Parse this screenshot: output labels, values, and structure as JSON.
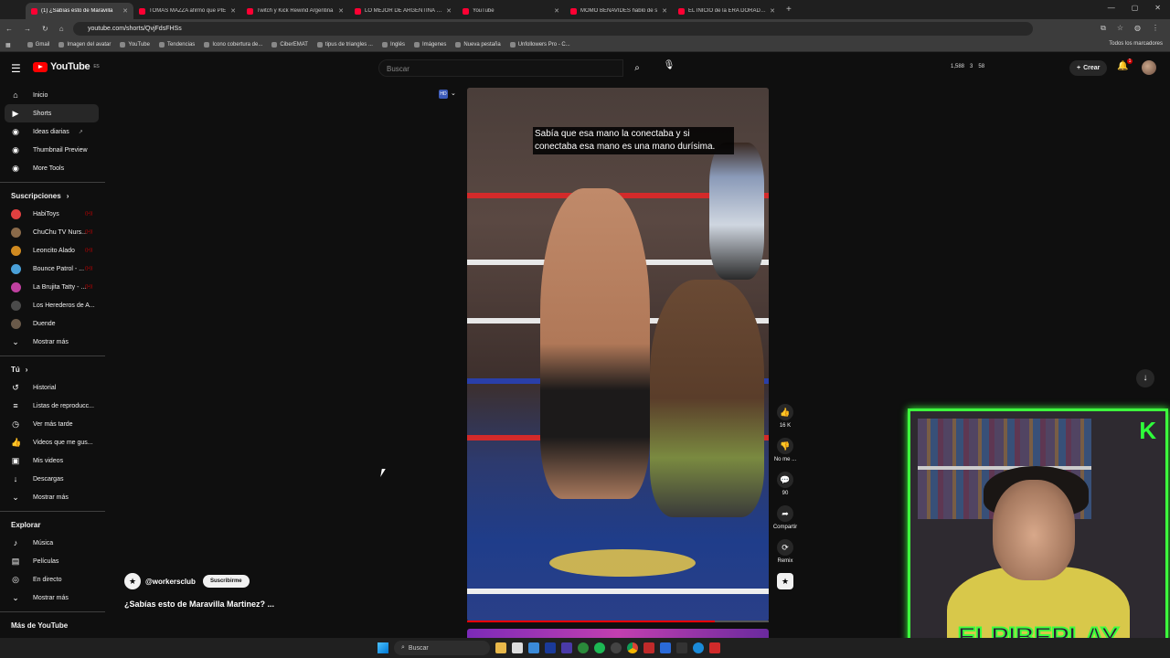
{
  "browser": {
    "tabs": [
      {
        "title": "(1) ¿Sabías esto de Maravilla",
        "active": true
      },
      {
        "title": "TOMAS MAZZA afirmó que PIE",
        "active": false
      },
      {
        "title": "Twitch y Kick Rewind Argentina",
        "active": false
      },
      {
        "title": "LO MEJOR DE ARGENTINA 2023",
        "active": false
      },
      {
        "title": "YouTube",
        "active": false
      },
      {
        "title": "MOMO BENAVIDES habló de s",
        "active": false
      },
      {
        "title": "EL INICIO de la ERA DORADA |",
        "active": false
      }
    ],
    "url": "youtube.com/shorts/QvjFdsFHSs",
    "bookmarks": [
      "Gmail",
      "Imagen del avatar",
      "YouTube",
      "Tendencias",
      "Icono cobertura de...",
      "CiberEMAT",
      "tipus de triangles ...",
      "Inglés",
      "Imágenes",
      "Nueva pestaña",
      "Unfollowers Pro - C..."
    ],
    "bookmarks_right": "Todos los marcadores"
  },
  "youtube": {
    "logo": "YouTube",
    "logo_sup": "ES",
    "search_placeholder": "Buscar",
    "stats": {
      "views": "1,588",
      "a": "3",
      "b": "58"
    },
    "create_label": "Crear",
    "notif_count": "1"
  },
  "sidebar": {
    "main": [
      {
        "label": "Inicio",
        "icon": "home-icon",
        "glyph": "⌂"
      },
      {
        "label": "Shorts",
        "icon": "shorts-icon",
        "glyph": "▶",
        "active": true
      },
      {
        "label": "Ideas diarias",
        "icon": "ideas-icon",
        "glyph": "◉"
      },
      {
        "label": "Thumbnail Preview",
        "icon": "thumbnail-icon",
        "glyph": "◉"
      },
      {
        "label": "More Tools",
        "icon": "tools-icon",
        "glyph": "◉"
      }
    ],
    "subs_title": "Suscripciones",
    "subs": [
      {
        "label": "HabiToys",
        "color": "#e04040"
      },
      {
        "label": "ChuChu TV Nurs...",
        "color": "#8a6a4a"
      },
      {
        "label": "Leoncito Alado",
        "color": "#d08a20"
      },
      {
        "label": "Bounce Patrol - ...",
        "color": "#4aa0d8"
      },
      {
        "label": "La Brujita Tatty - ...",
        "color": "#c040a0"
      },
      {
        "label": "Los Herederos de A...",
        "color": "#4a4a4a"
      },
      {
        "label": "Duende",
        "color": "#6a5a4a"
      }
    ],
    "show_more": "Mostrar más",
    "you_title": "Tú",
    "you": [
      {
        "label": "Historial",
        "glyph": "↺"
      },
      {
        "label": "Listas de reproducc...",
        "glyph": "≡"
      },
      {
        "label": "Ver más tarde",
        "glyph": "◷"
      },
      {
        "label": "Videos que me gus...",
        "glyph": "👍"
      },
      {
        "label": "Mis videos",
        "glyph": "▣"
      },
      {
        "label": "Descargas",
        "glyph": "↓"
      }
    ],
    "explore_title": "Explorar",
    "explore": [
      {
        "label": "Música",
        "glyph": "♪"
      },
      {
        "label": "Películas",
        "glyph": "▤"
      },
      {
        "label": "En directo",
        "glyph": "◎"
      }
    ],
    "more_title": "Más de YouTube"
  },
  "short": {
    "channel": "@workersclub",
    "subscribe": "Suscribirme",
    "title": "¿Sabías esto de Maravilla Martinez? ...",
    "caption": "Sabía que esa mano la conectaba y si conectaba esa mano es una mano durísima.",
    "progress_fraction": 0.82
  },
  "actions": [
    {
      "name": "like",
      "label": "16 K",
      "glyph": "👍"
    },
    {
      "name": "dislike",
      "label": "No me ...",
      "glyph": "👎"
    },
    {
      "name": "comments",
      "label": "90",
      "glyph": "💬"
    },
    {
      "name": "share",
      "label": "Compartir",
      "glyph": "➦"
    },
    {
      "name": "remix",
      "label": "Remix",
      "glyph": "⟳"
    }
  ],
  "webcam": {
    "overlay_name": "ELPIBEPLAY",
    "corner_letter": "K"
  },
  "taskbar": {
    "search": "Buscar"
  }
}
